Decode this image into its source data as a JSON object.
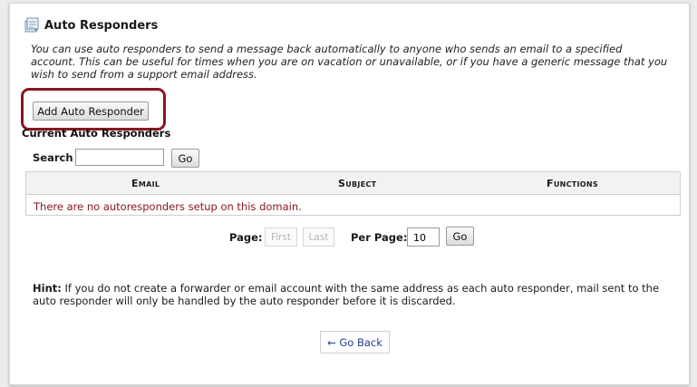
{
  "header": {
    "title": "Auto Responders",
    "icon": "autoresponder-icon"
  },
  "intro": "You can use auto responders to send a message back automatically to anyone who sends an email to a specified account. This can be useful for times when you are on vacation or unavailable, or if you have a generic message that you wish to send from a support email address.",
  "add_button": "Add Auto Responder",
  "current": {
    "heading": "Current Auto Responders",
    "search_label": "Search",
    "search_value": "",
    "search_go": "Go"
  },
  "table": {
    "columns": [
      "Email",
      "Subject",
      "Functions"
    ],
    "empty_message": "There are no autoresponders setup on this domain."
  },
  "pagination": {
    "page_label": "Page:",
    "first": "First",
    "last": "Last",
    "per_page_label": "Per Page:",
    "per_page_value": "10",
    "go": "Go"
  },
  "hint": {
    "label": "Hint:",
    "text": " If you do not create a forwarder or email account with the same address as each auto responder, mail sent to the auto responder will only be handled by the auto responder before it is discarded."
  },
  "go_back": "← Go Back",
  "colors": {
    "highlight": "#8a1620",
    "link": "#1f3f95",
    "error_text": "#8a1620"
  }
}
